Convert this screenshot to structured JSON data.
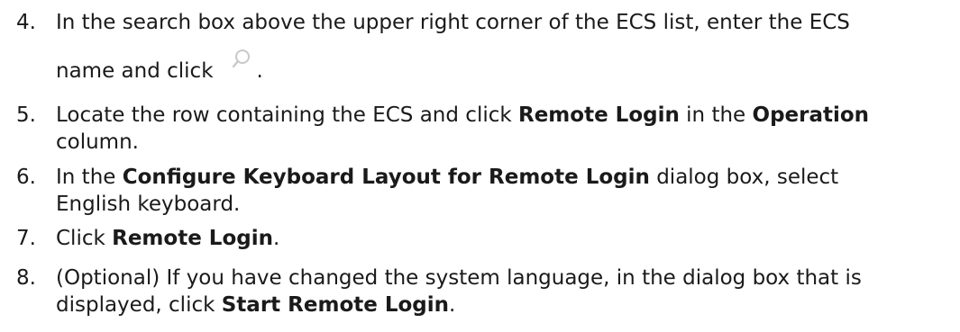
{
  "steps": [
    {
      "number": "4.",
      "line1": "In the search box above the upper right corner of the ECS list, enter the ECS",
      "line2_a": "name and click",
      "line2_icon": "search-icon",
      "line2_b": "."
    },
    {
      "number": "5.",
      "a": "Locate the row containing the ECS and click ",
      "b1": "Remote Login",
      "c": " in the ",
      "b2": "Operation",
      "line2": "column."
    },
    {
      "number": "6.",
      "a": "In the ",
      "b1": "Configure Keyboard Layout for Remote Login",
      "c": " dialog box, select",
      "line2": "English keyboard."
    },
    {
      "number": "7.",
      "a": "Click ",
      "b1": "Remote Login",
      "c": "."
    },
    {
      "number": "8.",
      "line1": "(Optional) If you have changed the system language, in the dialog box that is",
      "line2_a": "displayed, click ",
      "line2_b": "Start Remote Login",
      "line2_c": "."
    }
  ],
  "colors": {
    "text": "#1a1a1a",
    "icon": "#c8c8c8"
  }
}
